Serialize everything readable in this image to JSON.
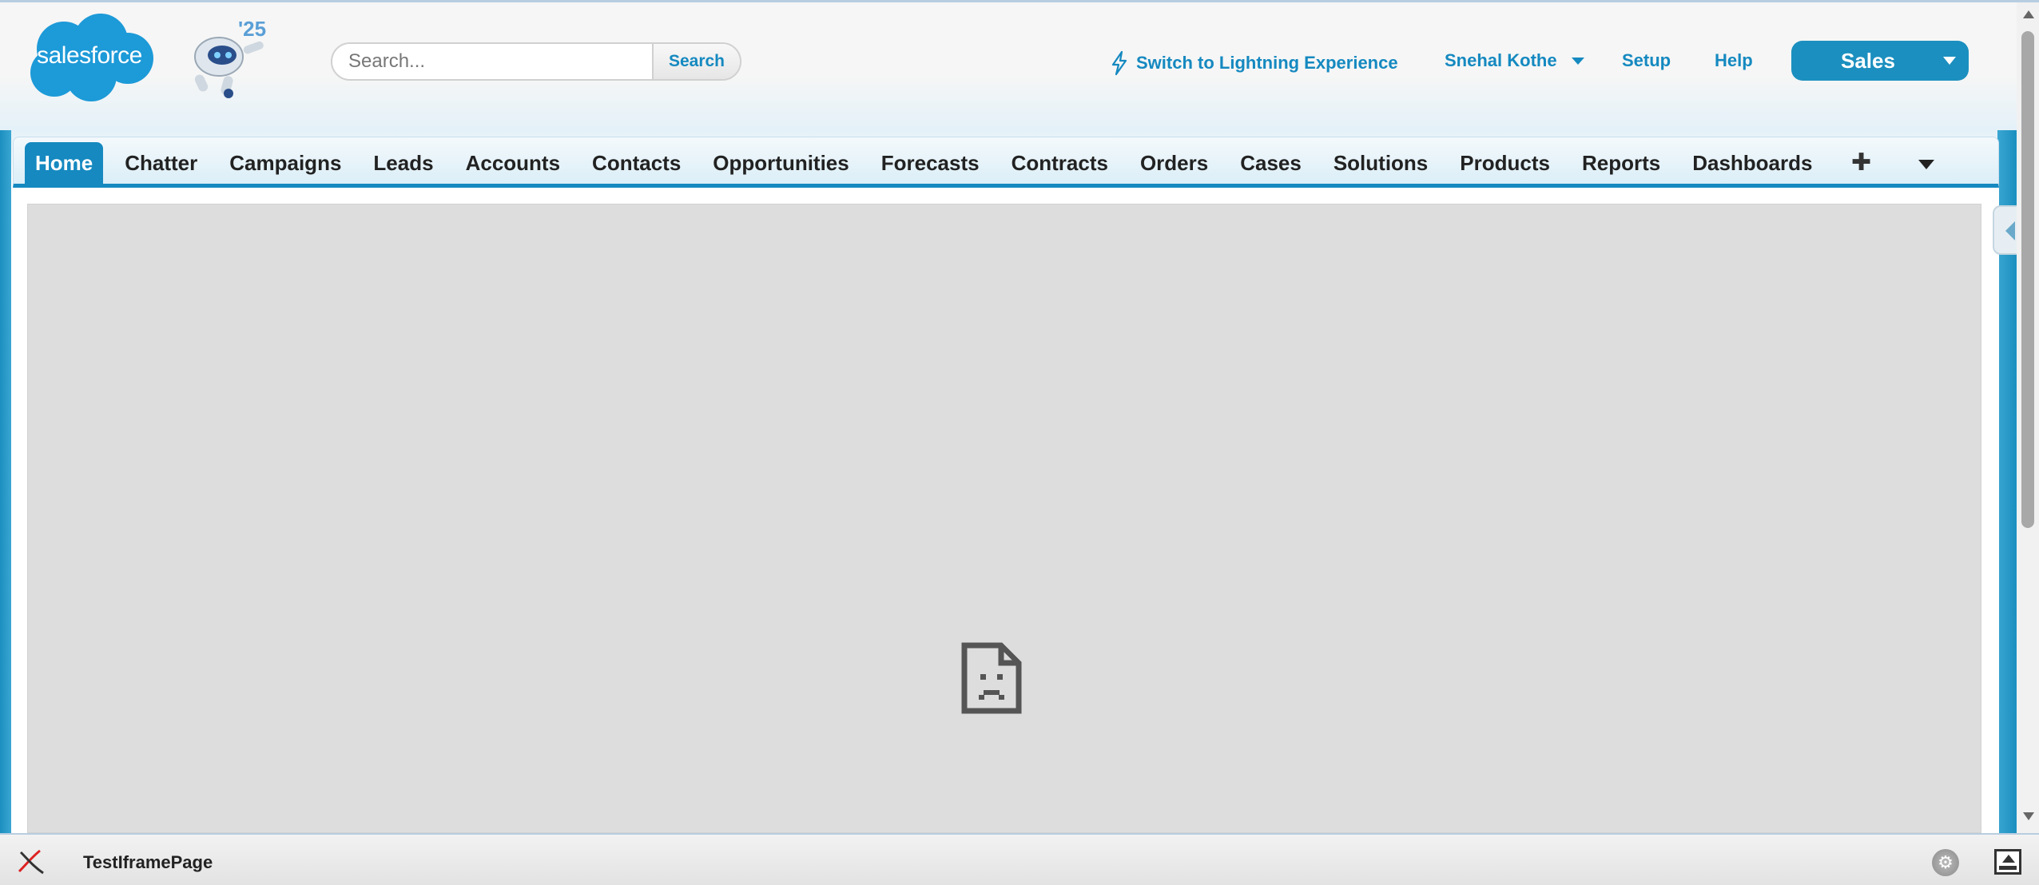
{
  "header": {
    "logo_text": "salesforce",
    "mascot_year": "'25",
    "search": {
      "placeholder": "Search...",
      "value": "",
      "button_label": "Search"
    },
    "lightning_link": "Switch to Lightning Experience",
    "user_name": "Snehal Kothe",
    "setup_label": "Setup",
    "help_label": "Help",
    "app_switcher_label": "Sales"
  },
  "tabs": [
    {
      "label": "Home",
      "active": true
    },
    {
      "label": "Chatter"
    },
    {
      "label": "Campaigns"
    },
    {
      "label": "Leads"
    },
    {
      "label": "Accounts"
    },
    {
      "label": "Contacts"
    },
    {
      "label": "Opportunities"
    },
    {
      "label": "Forecasts"
    },
    {
      "label": "Contracts"
    },
    {
      "label": "Orders"
    },
    {
      "label": "Cases"
    },
    {
      "label": "Solutions"
    },
    {
      "label": "Products"
    },
    {
      "label": "Reports"
    },
    {
      "label": "Dashboards"
    }
  ],
  "tabs_extra": {
    "plus_glyph": "✚"
  },
  "dev_footer": {
    "page_name": "TestIframePage",
    "tools_glyph": "⚙"
  },
  "colors": {
    "brand_blue": "#1589c0",
    "logo_blue": "#1d9ad8",
    "iframe_grey": "#dddddd"
  }
}
